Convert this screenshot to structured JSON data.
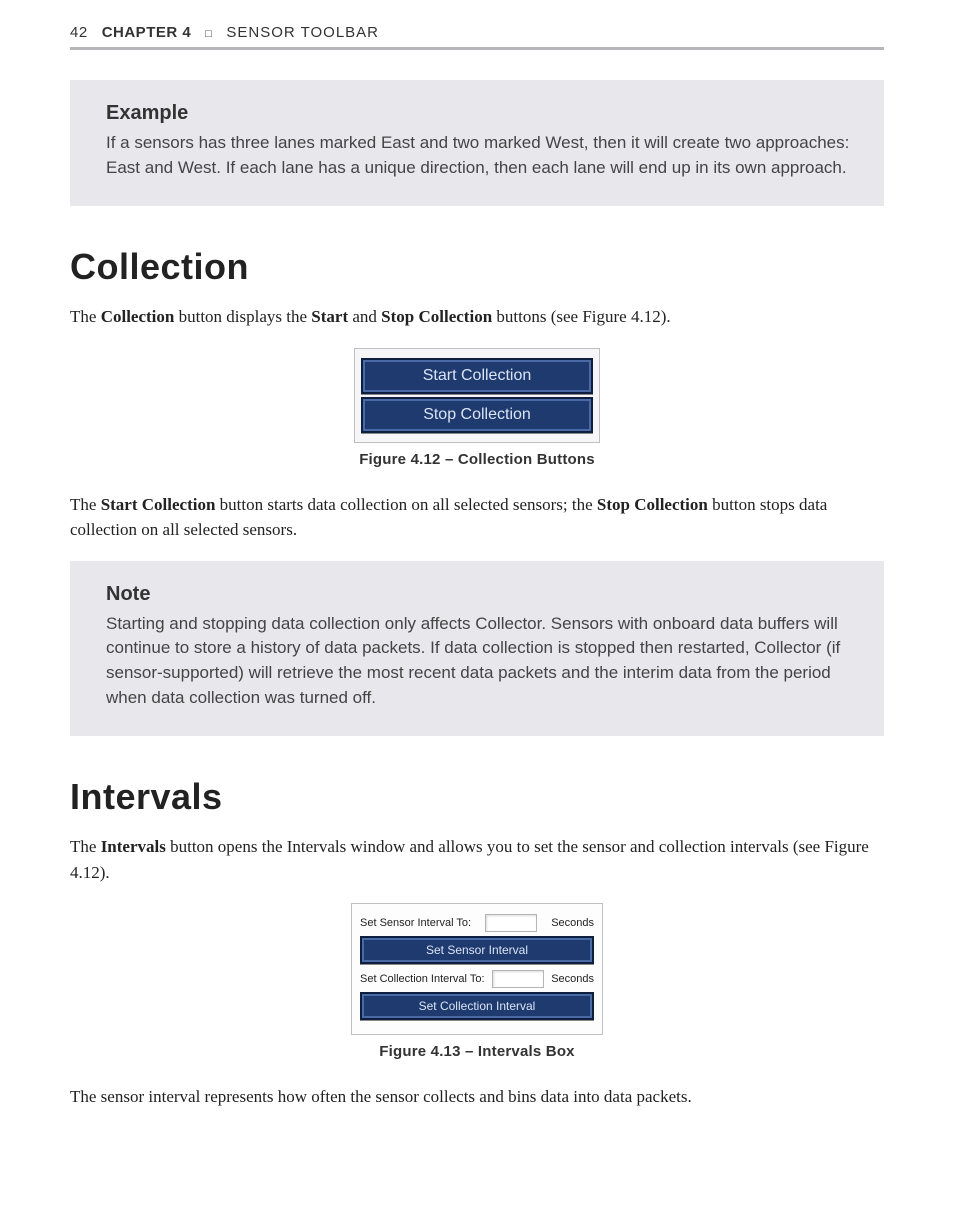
{
  "header": {
    "page_number": "42",
    "chapter_label": "CHAPTER 4",
    "divider_glyph": "□",
    "section_title": "SENSOR TOOLBAR"
  },
  "example_box": {
    "heading": "Example",
    "body": "If a sensors has three lanes marked East and two marked West, then it will create two approaches: East and West. If each lane has a unique direction, then each lane will end up in its own approach."
  },
  "collection": {
    "heading": "Collection",
    "intro_pre": "The ",
    "intro_b1": "Collection",
    "intro_mid1": " button displays the ",
    "intro_b2": "Start",
    "intro_mid2": " and ",
    "intro_b3": "Stop Collection",
    "intro_post": " buttons (see Figure 4.12).",
    "figure": {
      "start_label": "Start Collection",
      "stop_label": "Stop Collection",
      "caption": "Figure 4.12 – Collection Buttons"
    },
    "para2_pre": "The ",
    "para2_b1": "Start Collection",
    "para2_mid": " button starts data collection on all selected sensors; the ",
    "para2_b2": "Stop Collection",
    "para2_post": " button stops data collection on all selected sensors."
  },
  "note_box": {
    "heading": "Note",
    "body": "Starting and stopping data collection only affects Collector. Sensors with onboard data buffers will continue to store a history of data packets. If data collection is stopped then restarted, Collector (if sensor-supported) will retrieve the most recent data packets and the interim data from the period when data collection was turned off."
  },
  "intervals": {
    "heading": "Intervals",
    "intro_pre": "The ",
    "intro_b1": "Intervals",
    "intro_post": " button opens the Intervals window and allows you to set the sensor and collection intervals (see Figure 4.12).",
    "figure": {
      "sensor_label": "Set Sensor Interval To:",
      "sensor_unit": "Seconds",
      "sensor_btn": "Set Sensor Interval",
      "collection_label": "Set Collection Interval To:",
      "collection_unit": "Seconds",
      "collection_btn": "Set Collection Interval",
      "caption": "Figure 4.13 – Intervals Box"
    },
    "closing": "The sensor interval represents how often the sensor collects and bins data into data packets."
  }
}
